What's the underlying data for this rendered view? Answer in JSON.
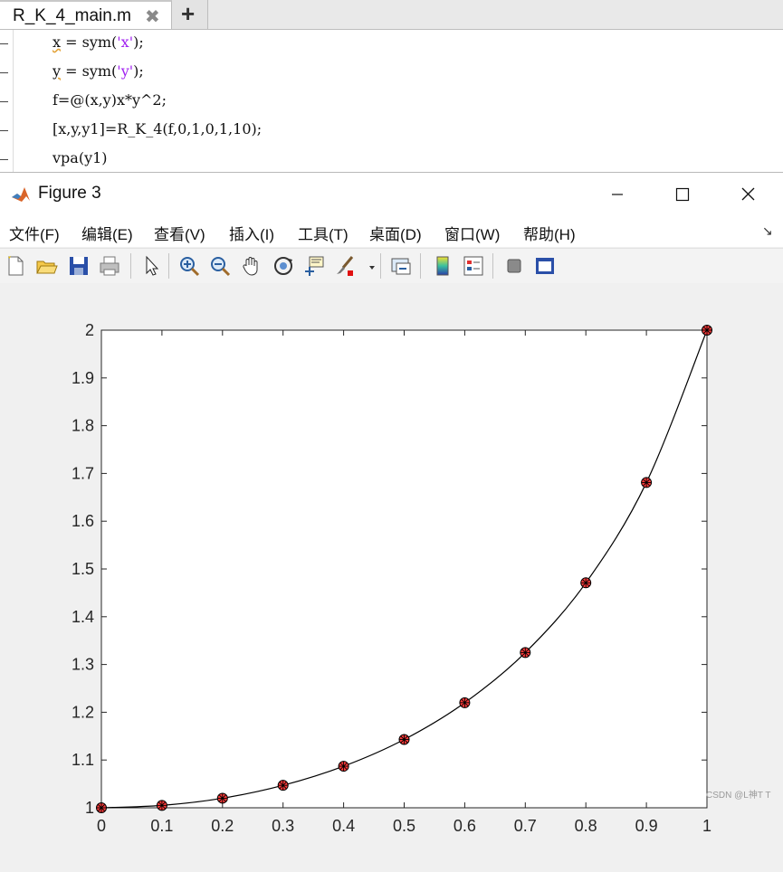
{
  "editor": {
    "tab_title": "R_K_4_main.m",
    "tab_close_icon": "close-icon",
    "add_tab_icon": "plus-icon",
    "lines": [
      {
        "parts": [
          {
            "t": "x",
            "c": "warn"
          },
          {
            "t": " = sym("
          },
          {
            "t": "'x'",
            "c": "str"
          },
          {
            "t": ");"
          }
        ]
      },
      {
        "parts": [
          {
            "t": "y",
            "c": "warn"
          },
          {
            "t": " = sym("
          },
          {
            "t": "'y'",
            "c": "str"
          },
          {
            "t": ");"
          }
        ]
      },
      {
        "parts": [
          {
            "t": "f=@(x,y)x*y^2;"
          }
        ]
      },
      {
        "parts": [
          {
            "t": "[x,y,y1]=R_K_4(f,0,1,0,1,10);"
          }
        ]
      },
      {
        "parts": [
          {
            "t": "vpa(y1)"
          }
        ]
      }
    ]
  },
  "figure": {
    "title": "Figure 3",
    "menu": [
      "文件(F)",
      "编辑(E)",
      "查看(V)",
      "插入(I)",
      "工具(T)",
      "桌面(D)",
      "窗口(W)",
      "帮助(H)"
    ],
    "menu_arrow": "↘",
    "toolbar_icons": [
      "new-figure-icon",
      "open-file-icon",
      "save-icon",
      "print-icon",
      "select-arrow-icon",
      "zoom-in-icon",
      "zoom-out-icon",
      "pan-hand-icon",
      "rotate-3d-icon",
      "data-cursor-icon",
      "brush-icon",
      "link-plot-icon",
      "colorbar-icon",
      "legend-icon",
      "hide-plot-tools-icon",
      "show-plot-tools-icon"
    ]
  },
  "watermark": "CSDN @L神T T",
  "chart_data": {
    "type": "line",
    "title": "",
    "xlabel": "",
    "ylabel": "",
    "xlim": [
      0,
      1
    ],
    "ylim": [
      1,
      2
    ],
    "xticks": [
      0,
      0.1,
      0.2,
      0.3,
      0.4,
      0.5,
      0.6,
      0.7,
      0.8,
      0.9,
      1
    ],
    "xtick_labels": [
      "0",
      "0.1",
      "0.2",
      "0.3",
      "0.4",
      "0.5",
      "0.6",
      "0.7",
      "0.8",
      "0.9",
      "1"
    ],
    "yticks": [
      1,
      1.1,
      1.2,
      1.3,
      1.4,
      1.5,
      1.6,
      1.7,
      1.8,
      1.9,
      2
    ],
    "ytick_labels": [
      "1",
      "1.1",
      "1.2",
      "1.3",
      "1.4",
      "1.5",
      "1.6",
      "1.7",
      "1.8",
      "1.9",
      "2"
    ],
    "grid": false,
    "series": [
      {
        "type": "line",
        "color": "#000000",
        "x": [
          0,
          0.1,
          0.2,
          0.3,
          0.4,
          0.5,
          0.6,
          0.7,
          0.8,
          0.9,
          1
        ],
        "y": [
          1.0,
          1.005,
          1.02,
          1.047,
          1.087,
          1.143,
          1.22,
          1.325,
          1.471,
          1.681,
          2.0
        ]
      },
      {
        "type": "scatter",
        "marker": "circle-star",
        "fill": "#ff3b3b",
        "edge": "#000000",
        "x": [
          0,
          0.1,
          0.2,
          0.3,
          0.4,
          0.5,
          0.6,
          0.7,
          0.8,
          0.9,
          1
        ],
        "y": [
          1.0,
          1.005,
          1.02,
          1.047,
          1.087,
          1.143,
          1.22,
          1.325,
          1.471,
          1.681,
          2.0
        ]
      }
    ]
  }
}
